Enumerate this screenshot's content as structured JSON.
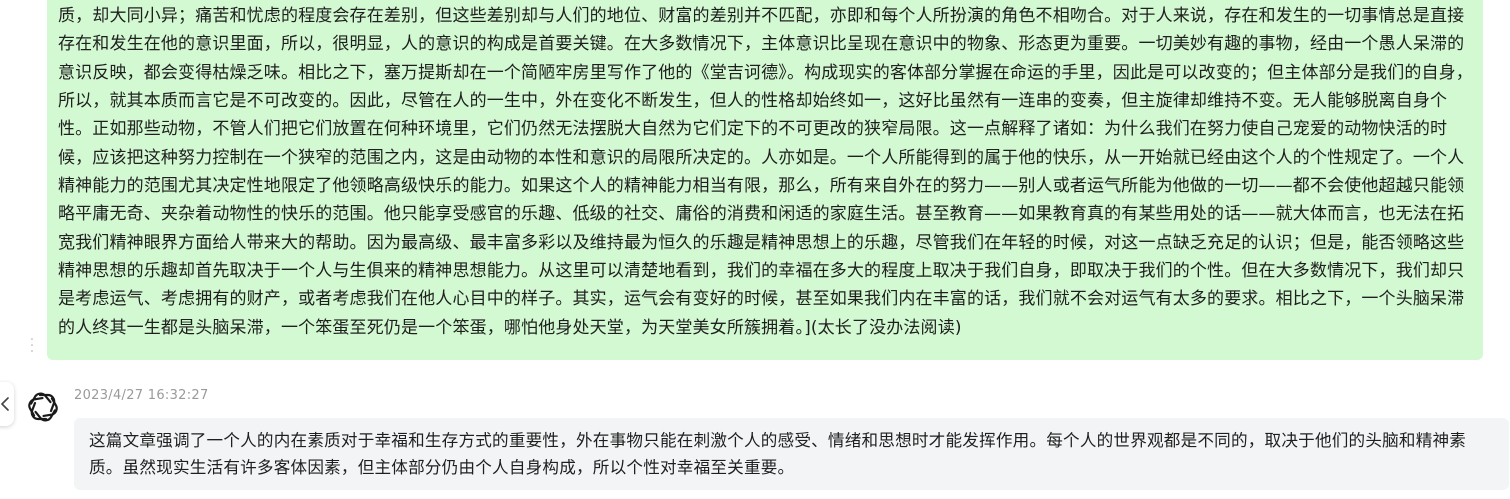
{
  "user_message": {
    "text": "质，却大同小异；痛苦和忧虑的程度会存在差别，但这些差别却与人们的地位、财富的差别并不匹配，亦即和每个人所扮演的角色不相吻合。对于人来说，存在和发生的一切事情总是直接存在和发生在他的意识里面，所以，很明显，人的意识的构成是首要关键。在大多数情况下，主体意识比呈现在意识中的物象、形态更为重要。一切美妙有趣的事物，经由一个愚人呆滞的意识反映，都会变得枯燥乏味。相比之下，塞万提斯却在一个简陋牢房里写作了他的《堂吉诃德》。构成现实的客体部分掌握在命运的手里，因此是可以改变的；但主体部分是我们的自身，所以，就其本质而言它是不可改变的。因此，尽管在人的一生中，外在变化不断发生，但人的性格却始终如一，这好比虽然有一连串的变奏，但主旋律却维持不变。无人能够脱离自身个性。正如那些动物，不管人们把它们放置在何种环境里，它们仍然无法摆脱大自然为它们定下的不可更改的狭窄局限。这一点解释了诸如：为什么我们在努力使自己宠爱的动物快活的时候，应该把这种努力控制在一个狭窄的范围之内，这是由动物的本性和意识的局限所决定的。人亦如是。一个人所能得到的属于他的快乐，从一开始就已经由这个人的个性规定了。一个人精神能力的范围尤其决定性地限定了他领略高级快乐的能力。如果这个人的精神能力相当有限，那么，所有来自外在的努力——别人或者运气所能为他做的一切——都不会使他超越只能领略平庸无奇、夹杂着动物性的快乐的范围。他只能享受感官的乐趣、低级的社交、庸俗的消费和闲适的家庭生活。甚至教育——如果教育真的有某些用处的话——就大体而言，也无法在拓宽我们精神眼界方面给人带来大的帮助。因为最高级、最丰富多彩以及维持最为恒久的乐趣是精神思想上的乐趣，尽管我们在年轻的时候，对这一点缺乏充足的认识；但是，能否领略这些精神思想的乐趣却首先取决于一个人与生俱来的精神思想能力。从这里可以清楚地看到，我们的幸福在多大的程度上取决于我们自身，即取决于我们的个性。但在大多数情况下，我们却只是考虑运气、考虑拥有的财产，或者考虑我们在他人心目中的样子。其实，运气会有变好的时候，甚至如果我们内在丰富的话，我们就不会对运气有太多的要求。相比之下，一个头脑呆滞的人终其一生都是头脑呆滞，一个笨蛋至死仍是一个笨蛋，哪怕他身处天堂，为天堂美女所簇拥着。](太长了没办法阅读)",
    "bg_color": "#d2f9d1"
  },
  "assistant_message": {
    "timestamp": "2023/4/27 16:32:27",
    "text": "这篇文章强调了一个人的内在素质对于幸福和生存方式的重要性，外在事物只能在刺激个人的感受、情绪和思想时才能发挥作用。每个人的世界观都是不同的，取决于他们的头脑和精神素质。虽然现实生活有许多客体因素，但主体部分仍由个人自身构成，所以个性对幸福至关重要。",
    "bg_color": "#f3f4f6",
    "avatar_icon": "openai-logo-icon"
  },
  "icons": {
    "drag_handle": "drag-handle-icon",
    "collapse": "chevron-left-icon"
  }
}
